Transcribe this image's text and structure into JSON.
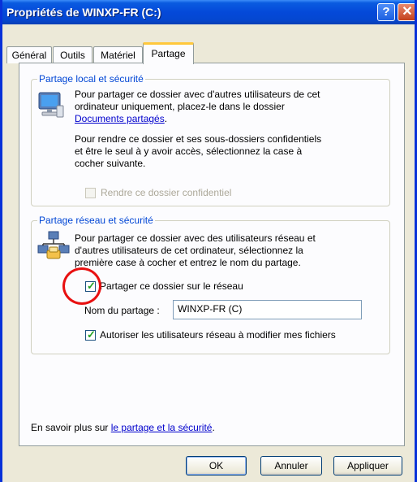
{
  "window": {
    "title": "Propriétés de WINXP-FR (C:)",
    "help_glyph": "?",
    "close_glyph": "✕"
  },
  "tabs": [
    {
      "label": "Général"
    },
    {
      "label": "Outils"
    },
    {
      "label": "Matériel"
    },
    {
      "label": "Partage",
      "active": true
    }
  ],
  "local": {
    "title": "Partage local et sécurité",
    "line1": "Pour partager ce dossier avec d'autres utilisateurs de cet",
    "line2": "ordinateur uniquement, placez-le dans le dossier",
    "link": "Documents partagés",
    "link_suffix": ".",
    "p2_line1": "Pour rendre ce dossier et ses sous-dossiers confidentiels",
    "p2_line2": "et être le seul à y avoir accès, sélectionnez la case à",
    "p2_line3": "cocher suivante.",
    "checkbox_label": "Rendre ce dossier confidentiel",
    "checkbox_checked": false,
    "checkbox_enabled": false
  },
  "network": {
    "title": "Partage réseau et sécurité",
    "line1": "Pour partager ce dossier avec des utilisateurs réseau et",
    "line2": "d'autres utilisateurs de cet ordinateur, sélectionnez la",
    "line3": "première case à cocher et entrez le nom du partage.",
    "share_checkbox_label": "Partager ce dossier sur le réseau",
    "share_checked": true,
    "share_name_label": "Nom du partage :",
    "share_name_value": "WINXP-FR (C)",
    "allow_checkbox_label": "Autoriser les utilisateurs réseau à modifier mes fichiers",
    "allow_checked": true
  },
  "footer": {
    "prefix": "En savoir plus sur ",
    "link": "le partage et la sécurité",
    "suffix": "."
  },
  "buttons": {
    "ok": "OK",
    "cancel": "Annuler",
    "apply": "Appliquer"
  },
  "colors": {
    "titlebar": "#0a5be0",
    "group_title": "#0046d5",
    "highlight_circle": "#e81010"
  }
}
